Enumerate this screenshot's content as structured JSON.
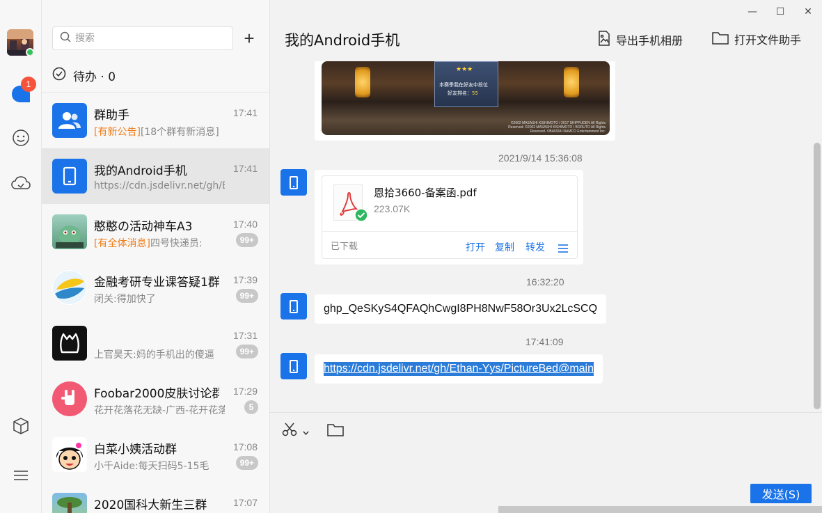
{
  "colors": {
    "accent": "#1a73e8",
    "badge": "#f5543b",
    "online": "#33c35a",
    "highlight": "#f27d17"
  },
  "rail": {
    "unread_badge": "1",
    "icons": [
      "avatar",
      "message-icon",
      "contacts-icon",
      "cloud-icon",
      "cube-icon",
      "menu-icon"
    ]
  },
  "list": {
    "search_placeholder": "搜索",
    "add_label": "+",
    "todo_label": "待办 · 0",
    "conversations": [
      {
        "name": "群助手",
        "preview_hl": "[有新公告]",
        "preview": "[18个群有新消息]",
        "time": "17:41",
        "count": ""
      },
      {
        "name": "我的Android手机",
        "preview_hl": "",
        "preview": "https://cdn.jsdelivr.net/gh/Eth",
        "time": "17:41",
        "count": ""
      },
      {
        "name": "憨憨の活动神车A3",
        "preview_hl": "[有全体消息]",
        "preview": "四号快递员:",
        "time": "17:40",
        "count": "99+"
      },
      {
        "name": "金融考研专业课答疑1群",
        "preview_hl": "",
        "preview": "闭关:得加快了",
        "time": "17:39",
        "count": "99+"
      },
      {
        "name": "",
        "preview_hl": "",
        "preview": "上官昊天:妈的手机出的傻逼",
        "time": "17:31",
        "count": "99+"
      },
      {
        "name": "Foobar2000皮肤讨论群",
        "preview_hl": "",
        "preview": "花开花落花无缺-广西-花开花落",
        "time": "17:29",
        "count": "5"
      },
      {
        "name": "白菜小姨活动群",
        "preview_hl": "",
        "preview": "小千Aide:每天扫码5-15毛",
        "time": "17:08",
        "count": "99+"
      },
      {
        "name": "2020国科大新生三群",
        "preview_hl": "",
        "preview": "",
        "time": "17:07",
        "count": ""
      }
    ]
  },
  "chat": {
    "window_controls": {
      "minimize": "—",
      "maximize": "☐",
      "close": "✕"
    },
    "title": "我的Android手机",
    "export_album_label": "导出手机相册",
    "open_file_helper_label": "打开文件助手",
    "game_image": {
      "line1": "本赛季我在好友中段位",
      "line2": "好友排名：",
      "rank": "55",
      "copyright": "©2002 MASASHI KISHIMOTO / 2017 SHIPPUDEN All Rights Reserved. ©2002 MASASHI KISHIMOTO / BORUTO All Rights Reserved. ©BANDAI NAMCO Entertainment Inc."
    },
    "messages": [
      {
        "timestamp": "2021/9/14 15:36:08"
      },
      {
        "timestamp": "16:32:20"
      },
      {
        "timestamp": "17:41:09"
      }
    ],
    "file": {
      "name": "恩拾3660-备案函.pdf",
      "size": "223.07K",
      "status": "已下载",
      "open": "打开",
      "copy": "复制",
      "forward": "转发"
    },
    "text_msg": "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",
    "link_msg": "https://cdn.jsdelivr.net/gh/Ethan-Yys/PictureBed@main",
    "send_label": "发送(S)"
  }
}
